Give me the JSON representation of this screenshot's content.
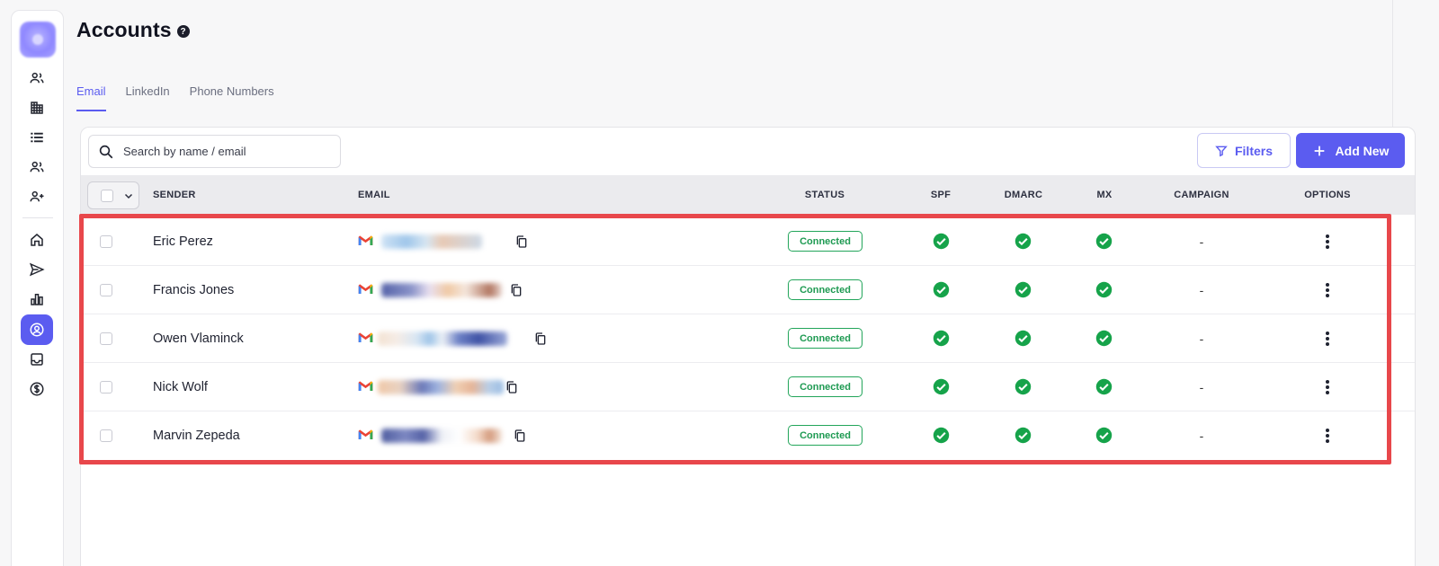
{
  "header": {
    "title": "Accounts",
    "help_glyph": "?"
  },
  "tabs": [
    {
      "label": "Email",
      "active": true
    },
    {
      "label": "LinkedIn",
      "active": false
    },
    {
      "label": "Phone Numbers",
      "active": false
    }
  ],
  "toolbar": {
    "search_placeholder": "Search by name / email",
    "filters_label": "Filters",
    "add_new_label": "Add New"
  },
  "table": {
    "columns": [
      "SENDER",
      "EMAIL",
      "STATUS",
      "SPF",
      "DMARC",
      "MX",
      "CAMPAIGN",
      "OPTIONS"
    ],
    "rows": [
      {
        "sender": "Eric Perez",
        "status": "Connected",
        "spf": true,
        "dmarc": true,
        "mx": true,
        "campaign": "-"
      },
      {
        "sender": "Francis Jones",
        "status": "Connected",
        "spf": true,
        "dmarc": true,
        "mx": true,
        "campaign": "-"
      },
      {
        "sender": "Owen Vlaminck",
        "status": "Connected",
        "spf": true,
        "dmarc": true,
        "mx": true,
        "campaign": "-"
      },
      {
        "sender": "Nick Wolf",
        "status": "Connected",
        "spf": true,
        "dmarc": true,
        "mx": true,
        "campaign": "-"
      },
      {
        "sender": "Marvin Zepeda",
        "status": "Connected",
        "spf": true,
        "dmarc": true,
        "mx": true,
        "campaign": "-"
      }
    ]
  },
  "sidebar": {
    "items": [
      {
        "icon": "people-icon"
      },
      {
        "icon": "building-icon"
      },
      {
        "icon": "list-icon"
      },
      {
        "icon": "people-icon"
      },
      {
        "icon": "add-user-icon"
      },
      {
        "icon": "home-icon"
      },
      {
        "icon": "send-icon"
      },
      {
        "icon": "bar-chart-icon"
      },
      {
        "icon": "account-icon",
        "active": true
      },
      {
        "icon": "inbox-icon"
      },
      {
        "icon": "dollar-icon"
      }
    ]
  },
  "colors": {
    "accent": "#5b5cf0",
    "success": "#16a34a",
    "highlight": "#e8474b"
  }
}
